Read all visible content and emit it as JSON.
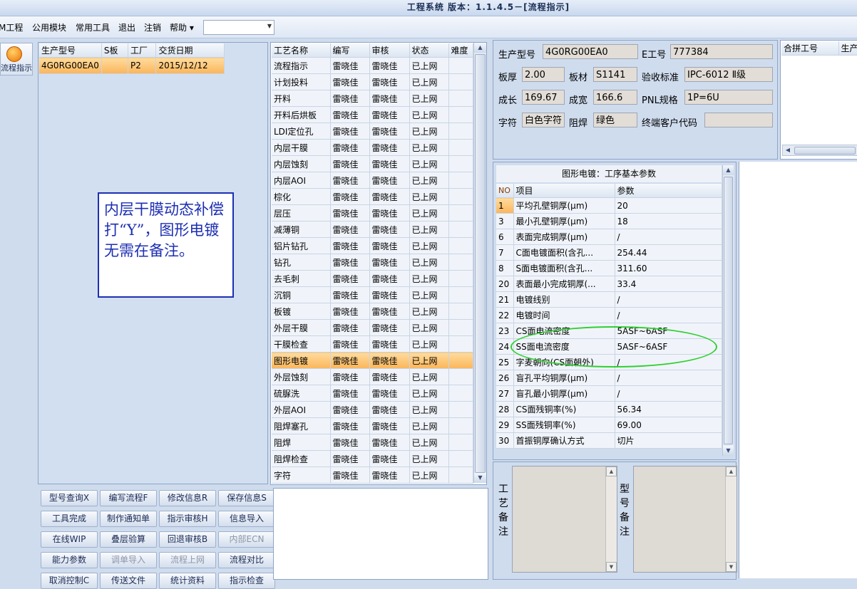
{
  "window": {
    "title": "工程系统 版本：1.1.4.5－[流程指示]"
  },
  "menu": {
    "items": [
      "M工程",
      "公用模块",
      "常用工具",
      "退出",
      "注销",
      "帮助 ▾"
    ],
    "combo_value": ""
  },
  "toolbar": {
    "flow_button_label": "流程指示"
  },
  "model_grid": {
    "headers": [
      "生产型号",
      "S板",
      "工厂",
      "交货日期"
    ],
    "rows": [
      [
        "4G0RG00EA0",
        "",
        "P2",
        "2015/12/12"
      ]
    ]
  },
  "annotation_note": "内层干膜动态补偿打“Y”，图形电镀无需在备注。",
  "process_grid": {
    "headers": [
      "工艺名称",
      "编写",
      "审核",
      "状态",
      "难度"
    ],
    "rows": [
      [
        "流程指示",
        "雷晓佳",
        "雷晓佳",
        "已上网",
        ""
      ],
      [
        "计划投料",
        "雷晓佳",
        "雷晓佳",
        "已上网",
        ""
      ],
      [
        "开料",
        "雷晓佳",
        "雷晓佳",
        "已上网",
        ""
      ],
      [
        "开料后烘板",
        "雷晓佳",
        "雷晓佳",
        "已上网",
        ""
      ],
      [
        "LDI定位孔",
        "雷晓佳",
        "雷晓佳",
        "已上网",
        ""
      ],
      [
        "内层干膜",
        "雷晓佳",
        "雷晓佳",
        "已上网",
        ""
      ],
      [
        "内层蚀刻",
        "雷晓佳",
        "雷晓佳",
        "已上网",
        ""
      ],
      [
        "内层AOI",
        "雷晓佳",
        "雷晓佳",
        "已上网",
        ""
      ],
      [
        "棕化",
        "雷晓佳",
        "雷晓佳",
        "已上网",
        ""
      ],
      [
        "层压",
        "雷晓佳",
        "雷晓佳",
        "已上网",
        ""
      ],
      [
        "减薄铜",
        "雷晓佳",
        "雷晓佳",
        "已上网",
        ""
      ],
      [
        "铝片钻孔",
        "雷晓佳",
        "雷晓佳",
        "已上网",
        ""
      ],
      [
        "钻孔",
        "雷晓佳",
        "雷晓佳",
        "已上网",
        ""
      ],
      [
        "去毛刺",
        "雷晓佳",
        "雷晓佳",
        "已上网",
        ""
      ],
      [
        "沉铜",
        "雷晓佳",
        "雷晓佳",
        "已上网",
        ""
      ],
      [
        "板镀",
        "雷晓佳",
        "雷晓佳",
        "已上网",
        ""
      ],
      [
        "外层干膜",
        "雷晓佳",
        "雷晓佳",
        "已上网",
        ""
      ],
      [
        "干膜检查",
        "雷晓佳",
        "雷晓佳",
        "已上网",
        ""
      ],
      [
        "图形电镀",
        "雷晓佳",
        "雷晓佳",
        "已上网",
        ""
      ],
      [
        "外层蚀刻",
        "雷晓佳",
        "雷晓佳",
        "已上网",
        ""
      ],
      [
        "硫脲洗",
        "雷晓佳",
        "雷晓佳",
        "已上网",
        ""
      ],
      [
        "外层AOI",
        "雷晓佳",
        "雷晓佳",
        "已上网",
        ""
      ],
      [
        "阻焊塞孔",
        "雷晓佳",
        "雷晓佳",
        "已上网",
        ""
      ],
      [
        "阻焊",
        "雷晓佳",
        "雷晓佳",
        "已上网",
        ""
      ],
      [
        "阻焊检查",
        "雷晓佳",
        "雷晓佳",
        "已上网",
        ""
      ],
      [
        "字符",
        "雷晓佳",
        "雷晓佳",
        "已上网",
        ""
      ]
    ],
    "selected_index": 18
  },
  "buttons": [
    [
      "型号查询X",
      "编写流程F",
      "修改信息R",
      "保存信息S"
    ],
    [
      "工具完成",
      "制作通知单",
      "指示审核H",
      "信息导入"
    ],
    [
      "在线WIP",
      "叠层验算",
      "回退审核B",
      "内部ECN"
    ],
    [
      "能力参数",
      "调单导入",
      "流程上网",
      "流程对比"
    ],
    [
      "取消控制C",
      "传送文件",
      "统计资料",
      "指示检查"
    ]
  ],
  "disabled_buttons": [
    "内部ECN",
    "调单导入",
    "流程上网"
  ],
  "info": {
    "labels": {
      "model": "生产型号",
      "e_no": "E工号",
      "thickness": "板厚",
      "material": "板材",
      "standard": "验收标准",
      "length": "成长",
      "width": "成宽",
      "pnl": "PNL规格",
      "char": "字符",
      "mask": "阻焊",
      "customer": "终端客户代码"
    },
    "values": {
      "model": "4G0RG00EA0",
      "e_no": "777384",
      "thickness": "2.00",
      "material": "S1141",
      "standard": "IPC-6012 Ⅱ级",
      "length": "169.67",
      "width": "166.6",
      "pnl": "1P=6U",
      "char": "白色字符",
      "mask": "绿色",
      "customer": ""
    }
  },
  "combine_grid": {
    "headers": [
      "合拼工号",
      "生产"
    ]
  },
  "param_grid": {
    "title": "图形电镀：工序基本参数",
    "headers": [
      "NO",
      "项目",
      "参数"
    ],
    "rows": [
      [
        "1",
        "平均孔壁铜厚(μm)",
        "20"
      ],
      [
        "3",
        "最小孔壁铜厚(μm)",
        "18"
      ],
      [
        "6",
        "表面完成铜厚(μm)",
        "/"
      ],
      [
        "7",
        "C面电镀面积(含孔...",
        "254.44"
      ],
      [
        "8",
        "S面电镀面积(含孔...",
        "311.60"
      ],
      [
        "20",
        "表面最小完成铜厚(...",
        "33.4"
      ],
      [
        "21",
        "电镀线别",
        "/"
      ],
      [
        "22",
        "电镀时间",
        "/"
      ],
      [
        "23",
        "CS面电流密度",
        "5ASF~6ASF"
      ],
      [
        "24",
        "SS面电流密度",
        "5ASF~6ASF"
      ],
      [
        "25",
        "字麦朝向(CS面朝外)",
        "/"
      ],
      [
        "26",
        "盲孔平均铜厚(μm)",
        "/"
      ],
      [
        "27",
        "盲孔最小铜厚(μm)",
        "/"
      ],
      [
        "28",
        "CS面残铜率(%)",
        "56.34"
      ],
      [
        "29",
        "SS面残铜率(%)",
        "69.00"
      ],
      [
        "30",
        "首振铜厚确认方式",
        "切片"
      ]
    ]
  },
  "memo": {
    "process_label": "工艺备注",
    "model_label": "型号备注",
    "process_text": "",
    "model_text": ""
  },
  "colors": {
    "accent_select": "#fbb55a",
    "annotation_blue": "#1d2fb2",
    "highlight_green": "#2fd02f"
  }
}
